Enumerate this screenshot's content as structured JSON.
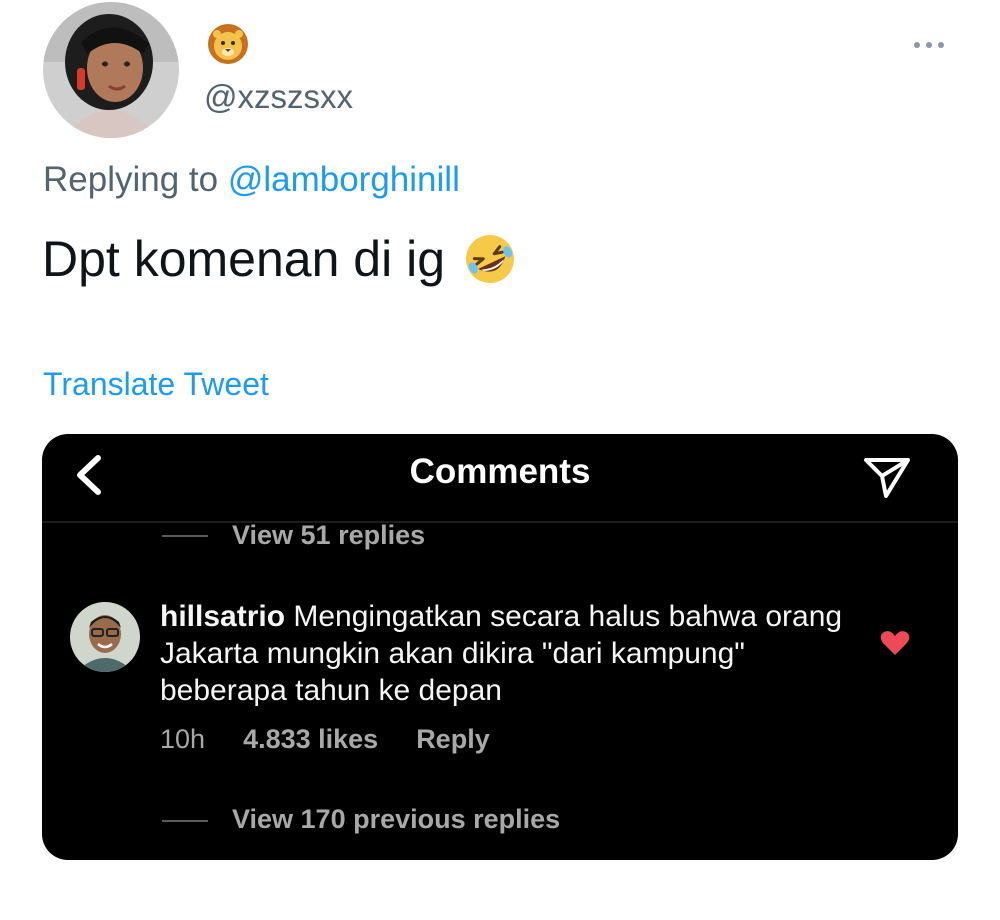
{
  "tweet": {
    "author": {
      "display_name_icon": "lion-face-emoji",
      "handle": "@xzszsxx"
    },
    "more_icon": "more-horizontal-icon",
    "replying_prefix": "Replying to ",
    "replying_to": "@lamborghinill",
    "text": "Dpt komenan di ig",
    "text_emoji": "rolling-on-floor-laughing-emoji",
    "translate_label": "Translate Tweet"
  },
  "embedded": {
    "title": "Comments",
    "back_icon": "chevron-left-icon",
    "send_icon": "paper-plane-icon",
    "view_replies_top": "View 51 replies",
    "comment": {
      "username": "hillsatrio",
      "text": " Mengingatkan secara halus bahwa orang Jakarta mungkin akan dikira \"dari kampung\" beberapa tahun ke depan",
      "time": "10h",
      "likes": "4.833 likes",
      "reply_label": "Reply",
      "liked_icon": "heart-icon",
      "liked_color": "#ed4956"
    },
    "view_replies_bottom": "View 170 previous replies"
  },
  "colors": {
    "accent": "#1d9bf0",
    "secondary_text": "#536471",
    "ig_background": "#000000"
  }
}
